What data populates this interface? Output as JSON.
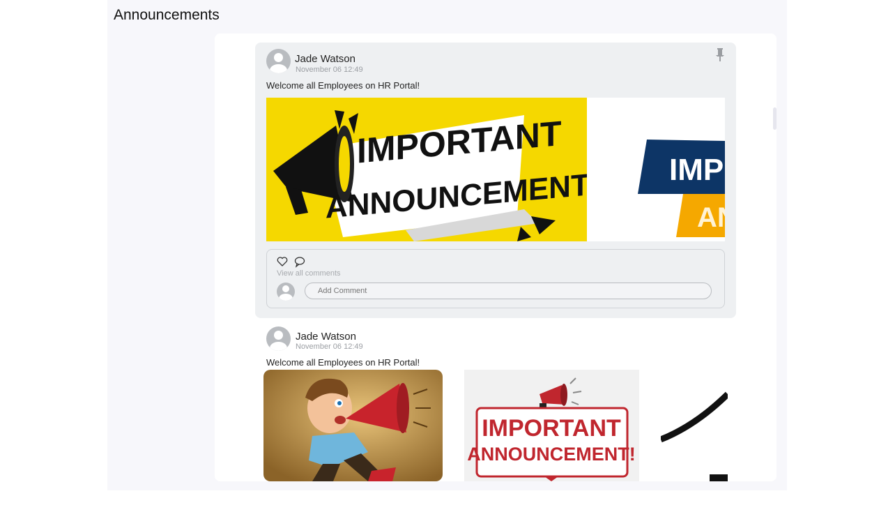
{
  "page": {
    "title": "Announcements"
  },
  "posts": [
    {
      "author": "Jade Watson",
      "date": "November 06 12:49",
      "text": "Welcome all Employees on HR Portal!",
      "pinned": true,
      "images": [
        {
          "name": "important-announcement-yellow",
          "lines": [
            "IMPORTANT",
            "ANNOUNCEMENT!"
          ]
        },
        {
          "name": "important-announcement-blue",
          "lines": [
            "IMP",
            "AN"
          ]
        }
      ],
      "view_all_comments": "View all comments",
      "comment_placeholder": "Add Comment"
    },
    {
      "author": "Jade Watson",
      "date": "November 06 12:49",
      "text": "Welcome all Employees on HR Portal!",
      "images": [
        {
          "name": "cartoon-megaphone-man"
        },
        {
          "name": "important-announcement-red",
          "lines": [
            "IMPORTANT",
            "ANNOUNCEMENT!"
          ]
        },
        {
          "name": "partial-black-curve"
        }
      ]
    }
  ],
  "icons": {
    "pin": "pin-icon",
    "like": "heart-icon",
    "comment": "comment-bubble-icon",
    "avatar": "user-avatar-icon"
  },
  "colors": {
    "yellow": "#f5d800",
    "navy": "#0d3566",
    "orange": "#f5a800",
    "red": "#c0262e"
  }
}
